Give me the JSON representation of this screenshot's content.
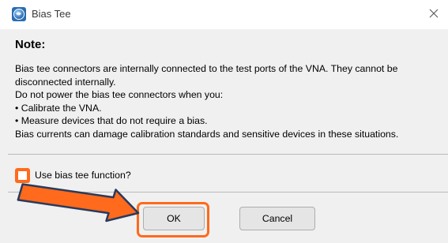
{
  "window": {
    "title": "Bias Tee",
    "app_icon": "globe-icon",
    "close_icon": "close-icon"
  },
  "note": {
    "heading": "Note:",
    "lines": [
      "Bias tee connectors are internally connected to the test ports of the VNA. They cannot be",
      "disconnected internally.",
      "Do not power the bias tee connectors when you:",
      "• Calibrate the VNA.",
      "• Measure devices that do not require a bias.",
      "Bias currents can damage calibration standards and sensitive devices in these situations."
    ]
  },
  "checkbox": {
    "label": "Use bias tee function?",
    "checked": false
  },
  "buttons": {
    "ok": "OK",
    "cancel": "Cancel"
  },
  "annotation": {
    "arrow_icon": "pointer-arrow-icon",
    "highlight_color": "#ff6a1c"
  }
}
